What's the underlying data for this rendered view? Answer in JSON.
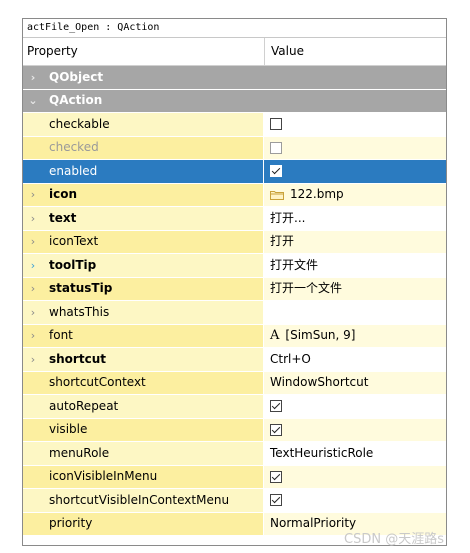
{
  "object_name": "actFile_Open : QAction",
  "header": {
    "property": "Property",
    "value": "Value"
  },
  "groups": {
    "qobject": "QObject",
    "qaction": "QAction"
  },
  "rows": [
    {
      "name": "checkable",
      "value": "",
      "checkbox": false
    },
    {
      "name": "checked",
      "value": "",
      "checkbox": false
    },
    {
      "name": "enabled",
      "value": "",
      "checkbox": true
    },
    {
      "name": "icon",
      "value": "122.bmp"
    },
    {
      "name": "text",
      "value": "打开..."
    },
    {
      "name": "iconText",
      "value": "打开"
    },
    {
      "name": "toolTip",
      "value": "打开文件"
    },
    {
      "name": "statusTip",
      "value": "打开一个文件"
    },
    {
      "name": "whatsThis",
      "value": ""
    },
    {
      "name": "font",
      "value": "[SimSun, 9]",
      "prefix": "A"
    },
    {
      "name": "shortcut",
      "value": "Ctrl+O"
    },
    {
      "name": "shortcutContext",
      "value": "WindowShortcut"
    },
    {
      "name": "autoRepeat",
      "value": "",
      "checkbox": true
    },
    {
      "name": "visible",
      "value": "",
      "checkbox": true
    },
    {
      "name": "menuRole",
      "value": "TextHeuristicRole"
    },
    {
      "name": "iconVisibleInMenu",
      "value": "",
      "checkbox": true
    },
    {
      "name": "shortcutVisibleInContextMenu",
      "value": "",
      "checkbox": true
    },
    {
      "name": "priority",
      "value": "NormalPriority"
    }
  ],
  "selected_row": "enabled",
  "watermark": "CSDN @天涯路s",
  "colors": {
    "group": "#a6a6a6",
    "selection": "#2b7bc0",
    "property_bg": "#fdf7c4"
  }
}
